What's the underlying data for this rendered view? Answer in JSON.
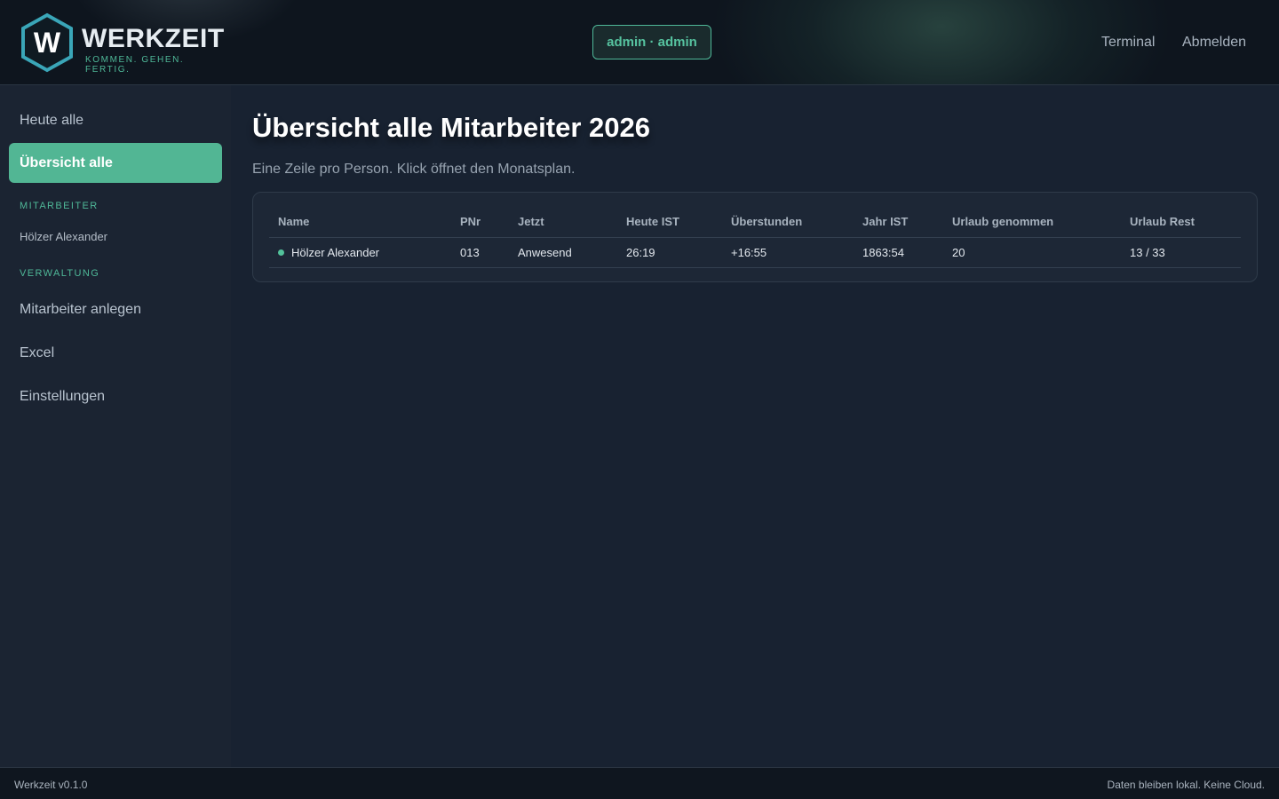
{
  "header": {
    "logo_letter": "W",
    "logo_name": "WERKZEIT",
    "logo_tagline": "KOMMEN. GEHEN. FERTIG.",
    "user_badge": "admin · admin",
    "links": {
      "terminal": "Terminal",
      "logout": "Abmelden"
    },
    "brand_color": "#4fb898"
  },
  "sidebar": {
    "items": [
      {
        "label": "Heute alle",
        "active": false
      },
      {
        "label": "Übersicht alle",
        "active": true
      }
    ],
    "section_employees": "MITARBEITER",
    "employees": [
      "Hölzer Alexander"
    ],
    "section_admin": "VERWALTUNG",
    "admin_items": [
      {
        "label": "Mitarbeiter anlegen"
      },
      {
        "label": "Excel"
      },
      {
        "label": "Einstellungen"
      }
    ],
    "active_color": "#52b694"
  },
  "main": {
    "title": "Übersicht alle Mitarbeiter 2026",
    "subtitle": "Eine Zeile pro Person. Klick öffnet den Monatsplan.",
    "table": {
      "columns": [
        "Name",
        "PNr",
        "Jetzt",
        "Heute IST",
        "Überstunden",
        "Jahr IST",
        "Urlaub genommen",
        "Urlaub Rest"
      ],
      "rows": [
        {
          "name": "Hölzer Alexander",
          "pnr": "013",
          "status": "Anwesend",
          "today_actual": "26:19",
          "overtime": "+16:55",
          "year_actual": "1863:54",
          "vacation_taken": "20",
          "vacation_rest": "13 / 33",
          "status_color": "#52c29b"
        }
      ]
    }
  },
  "footer": {
    "version": "Werkzeit v0.1.0",
    "note": "Daten bleiben lokal. Keine Cloud."
  }
}
